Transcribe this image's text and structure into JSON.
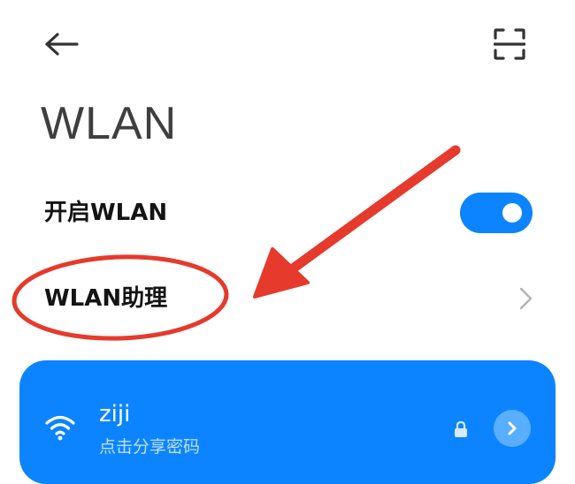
{
  "header": {
    "back_icon": "arrow-left-icon",
    "scan_icon": "scan-qr-icon"
  },
  "page": {
    "title": "WLAN"
  },
  "settings": {
    "wlan_toggle": {
      "label": "开启WLAN",
      "state": "on"
    },
    "wlan_assistant": {
      "label": "WLAN助理",
      "icon": "chevron-right-icon"
    }
  },
  "connected_network": {
    "name": "ziji",
    "subtitle": "点击分享密码",
    "icons": [
      "wifi-icon",
      "lock-icon",
      "chevron-right-icon"
    ]
  },
  "colors": {
    "accent": "#0c84ff",
    "annotation": "#e53a2c"
  }
}
